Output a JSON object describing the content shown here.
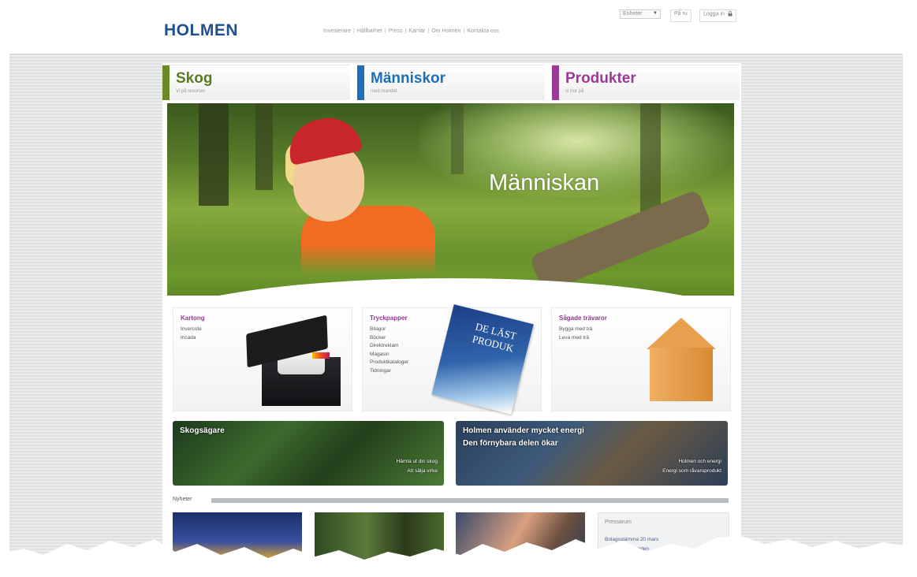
{
  "header": {
    "logo": "HOLMEN",
    "nav": [
      "Investerare",
      "Hållbarhet",
      "Press",
      "Karriär",
      "Om Holmen",
      "Kontakta oss"
    ],
    "nav_separator": "|",
    "site_select": "Enheter",
    "site_select_arrow": "▼",
    "lang": "På ru",
    "login": "Logga in"
  },
  "tabs": [
    {
      "title": "Skog",
      "sub": "Vi på resurser",
      "color": "#6a8a2a",
      "text_color": "#5b7a24"
    },
    {
      "title": "Människor",
      "sub": "med mandat",
      "color": "#1d6fb8",
      "text_color": "#1d6fb8"
    },
    {
      "title": "Produkter",
      "sub": "vi tror på",
      "color": "#9a3c96",
      "text_color": "#9a3c96"
    }
  ],
  "hero": {
    "title": "Människan"
  },
  "products": [
    {
      "title": "Kartong",
      "items": [
        "Invercote",
        "Incada"
      ]
    },
    {
      "title": "Tryckpapper",
      "items": [
        "Bilagor",
        "Böcker",
        "Direktreklam",
        "Magasin",
        "Produktkataloger",
        "Tidningar"
      ]
    },
    {
      "title": "Sågade trävaror",
      "items": [
        "Bygga med trä",
        "Leva med trä"
      ]
    }
  ],
  "magazine_cover_text": "DE LÄST PRODUK",
  "banners": [
    {
      "line1": "Skogsägare",
      "line2": "",
      "links": [
        "Hämta ut din skog",
        "Att sälja virke"
      ]
    },
    {
      "line1": "Holmen använder mycket energi",
      "line2": "Den förnybara delen ökar",
      "links": [
        "Holmen och energi",
        "Energi som råvaruprodukt"
      ]
    }
  ],
  "news": {
    "heading": "Nyheter"
  },
  "press": {
    "heading": "Pressarum",
    "items": [
      "Bolagsstämma 20 mars",
      "Pressmeddelanden"
    ]
  },
  "colors": {
    "brand": "#1e4f91",
    "product_title": "#8e3c8e",
    "background": "#e3e4e7"
  }
}
